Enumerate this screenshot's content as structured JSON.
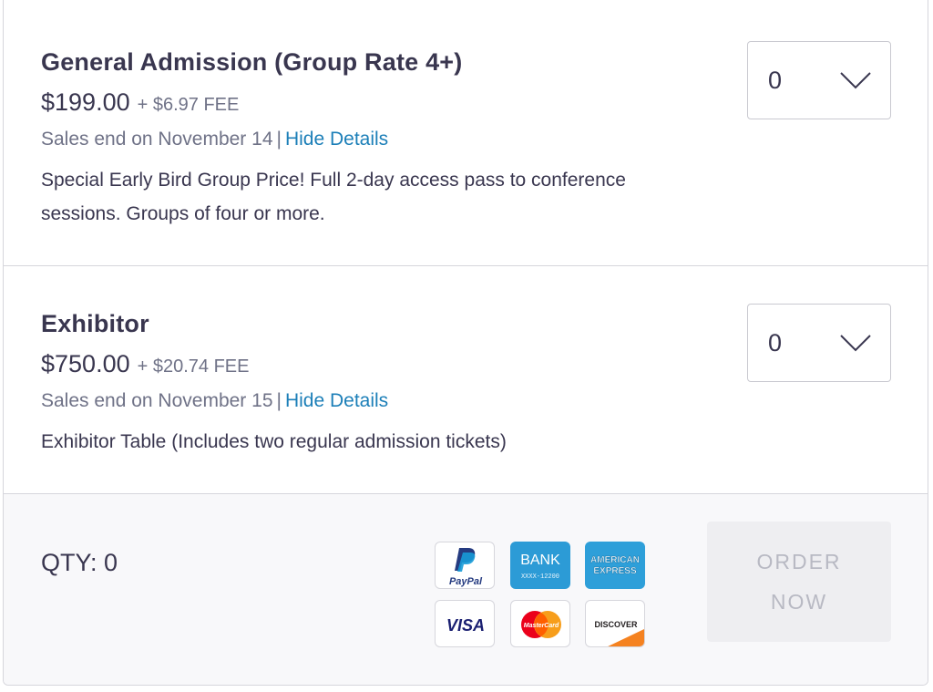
{
  "tickets": [
    {
      "name": "General Admission (Group Rate 4+)",
      "price": "$199.00",
      "fee": "+ $6.97 FEE",
      "sales_end": "Sales end on November 14",
      "separator": "|",
      "details_link": "Hide Details",
      "description": "Special Early Bird Group Price! Full 2-day access pass to conference sessions. Groups of four or more.",
      "quantity": "0"
    },
    {
      "name": "Exhibitor",
      "price": "$750.00",
      "fee": "+ $20.74 FEE",
      "sales_end": "Sales end on November 15",
      "separator": "|",
      "details_link": "Hide Details",
      "description": "Exhibitor Table (Includes two regular admission tickets)",
      "quantity": "0"
    }
  ],
  "footer": {
    "qty_label": "QTY: 0",
    "order_button": [
      "ORDER",
      "NOW"
    ],
    "payment_methods": [
      {
        "name": "paypal-icon",
        "label": "PayPal"
      },
      {
        "name": "bank-icon",
        "label": "BANK",
        "sub": "XXXX-12200"
      },
      {
        "name": "amex-icon",
        "label": [
          "AMERICAN",
          "EXPRESS"
        ]
      },
      {
        "name": "visa-icon",
        "label": "VISA"
      },
      {
        "name": "mastercard-icon",
        "label": "MasterCard"
      },
      {
        "name": "discover-icon",
        "label": "DISCOVER"
      }
    ]
  },
  "colors": {
    "text": "#39364f",
    "muted": "#6f7287",
    "link": "#1c7fb8",
    "border": "#d6d6dc",
    "footer_bg": "#f8f8fa",
    "button_disabled_bg": "#eeeef1",
    "button_disabled_text": "#b8b9c3"
  }
}
